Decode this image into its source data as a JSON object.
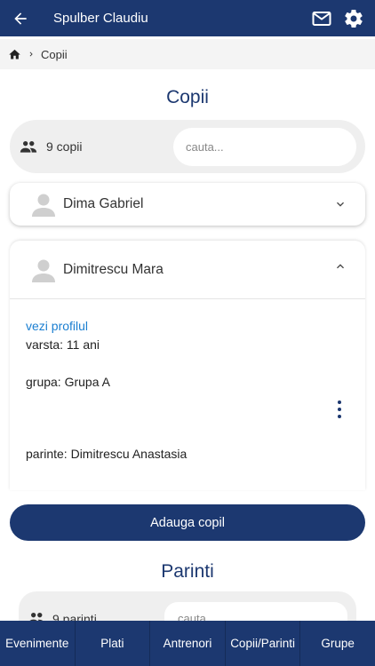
{
  "header": {
    "title": "Spulber Claudiu",
    "back_icon": "arrow-left-icon",
    "mail_icon": "mail-icon",
    "settings_icon": "gear-icon",
    "bg_color": "#1c3870"
  },
  "breadcrumb": {
    "home_icon": "home-icon",
    "current": "Copii"
  },
  "copii": {
    "title": "Copii",
    "count": "9 copii",
    "search_placeholder": "cauta..."
  },
  "children": [
    {
      "name": "Dima Gabriel",
      "expanded": false
    },
    {
      "name": "Dimitrescu Mara",
      "expanded": true,
      "profile_link": "vezi profilul",
      "age": "varsta: 11 ani",
      "group": "grupa: Grupa A",
      "parent": "parinte: Dimitrescu Anastasia"
    }
  ],
  "add_button": "Adauga copil",
  "parinti": {
    "title": "Parinti",
    "count": "9 parinti",
    "search_placeholder": "cauta..."
  },
  "tabs": [
    "Evenimente",
    "Plati",
    "Antrenori",
    "Copii/Parinti",
    "Grupe"
  ],
  "colors": {
    "primary": "#1c3870",
    "link": "#1b7fd1"
  }
}
